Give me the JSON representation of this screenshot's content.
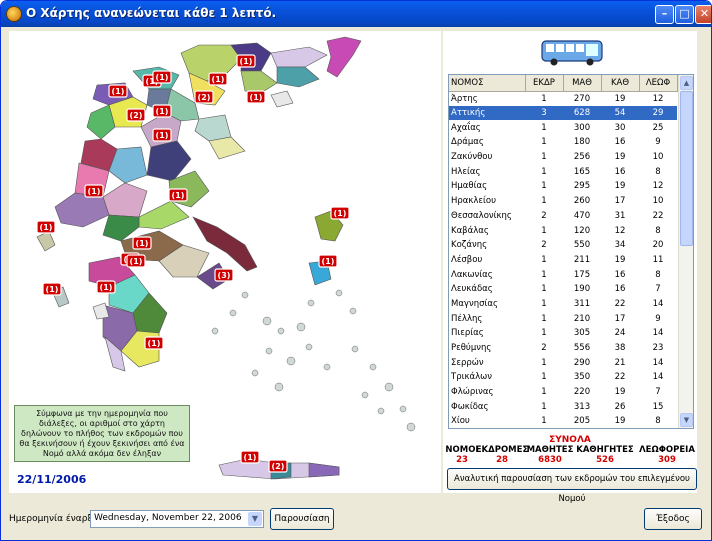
{
  "window": {
    "title": "Ο Χάρτης ανανεώνεται κάθε 1 λεπτό."
  },
  "map": {
    "legend": "Σύμφωνα με την ημερομηνία που διάλεξες, οι αριθμοί στο χάρτη δηλώνουν το πλήθος των εκδρομών που θα ξεκινήσουν ή έχουν ξεκινήσει από ένα Νομό αλλά ακόμα δεν έληξαν",
    "date": "22/11/2006",
    "badges": [
      "(1)",
      "(1)",
      "(1)",
      "(1)",
      "(2)",
      "(1)",
      "(2)",
      "(1)",
      "(1)",
      "(1)",
      "(1)",
      "(1)",
      "(1)",
      "(1)",
      "(1)",
      "(1)",
      "(1)",
      "(1)",
      "(3)",
      "(1)",
      "(1)",
      "(1)",
      "(2)",
      "(1)"
    ]
  },
  "grid": {
    "headers": [
      "ΝΟΜΟΣ",
      "ΕΚΔΡ",
      "ΜΑΘ",
      "ΚΑΘ",
      "ΛΕΩΦ"
    ],
    "rows": [
      [
        "Άρτης",
        "1",
        "270",
        "19",
        "12"
      ],
      [
        "Αττικής",
        "3",
        "628",
        "54",
        "29"
      ],
      [
        "Αχαΐας",
        "1",
        "300",
        "30",
        "25"
      ],
      [
        "Δράμας",
        "1",
        "180",
        "16",
        "9"
      ],
      [
        "Ζακύνθου",
        "1",
        "256",
        "19",
        "10"
      ],
      [
        "Ηλείας",
        "1",
        "165",
        "16",
        "8"
      ],
      [
        "Ημαθίας",
        "1",
        "295",
        "19",
        "12"
      ],
      [
        "Ηρακλείου",
        "1",
        "260",
        "17",
        "10"
      ],
      [
        "Θεσσαλονίκης",
        "2",
        "470",
        "31",
        "22"
      ],
      [
        "Καβάλας",
        "1",
        "120",
        "12",
        "8"
      ],
      [
        "Κοζάνης",
        "2",
        "550",
        "34",
        "20"
      ],
      [
        "Λέσβου",
        "1",
        "211",
        "19",
        "11"
      ],
      [
        "Λακωνίας",
        "1",
        "175",
        "16",
        "8"
      ],
      [
        "Λευκάδας",
        "1",
        "190",
        "16",
        "7"
      ],
      [
        "Μαγνησίας",
        "1",
        "311",
        "22",
        "14"
      ],
      [
        "Πέλλης",
        "1",
        "210",
        "17",
        "9"
      ],
      [
        "Πιερίας",
        "1",
        "305",
        "24",
        "14"
      ],
      [
        "Ρεθύμνης",
        "2",
        "556",
        "38",
        "23"
      ],
      [
        "Σερρών",
        "1",
        "290",
        "21",
        "14"
      ],
      [
        "Τρικάλων",
        "1",
        "350",
        "22",
        "14"
      ],
      [
        "Φλώρινας",
        "1",
        "220",
        "19",
        "7"
      ],
      [
        "Φωκίδας",
        "1",
        "313",
        "26",
        "15"
      ],
      [
        "Χίου",
        "1",
        "205",
        "19",
        "8"
      ]
    ],
    "selected_row": 1
  },
  "totals": {
    "title": "ΣΥΝΟΛΑ",
    "items": [
      {
        "label": "ΝΟΜΟΙ",
        "value": "23"
      },
      {
        "label": "ΕΚΔΡΟΜΕΣ",
        "value": "28"
      },
      {
        "label": "ΜΑΘΗΤΕΣ",
        "value": "6830"
      },
      {
        "label": "ΚΑΘΗΓΗΤΕΣ",
        "value": "526"
      },
      {
        "label": "ΛΕΩΦΟΡΕΙΑ",
        "value": "309"
      }
    ]
  },
  "buttons": {
    "detail": "Αναλυτική παρουσίαση των εκδρομών του επιλεγμένου Νομού",
    "show": "Παρουσίαση",
    "exit": "Έξοδος"
  },
  "start": {
    "label": "Ημερομηνία έναρξης",
    "value": "Wednesday, November 22, 2006"
  }
}
